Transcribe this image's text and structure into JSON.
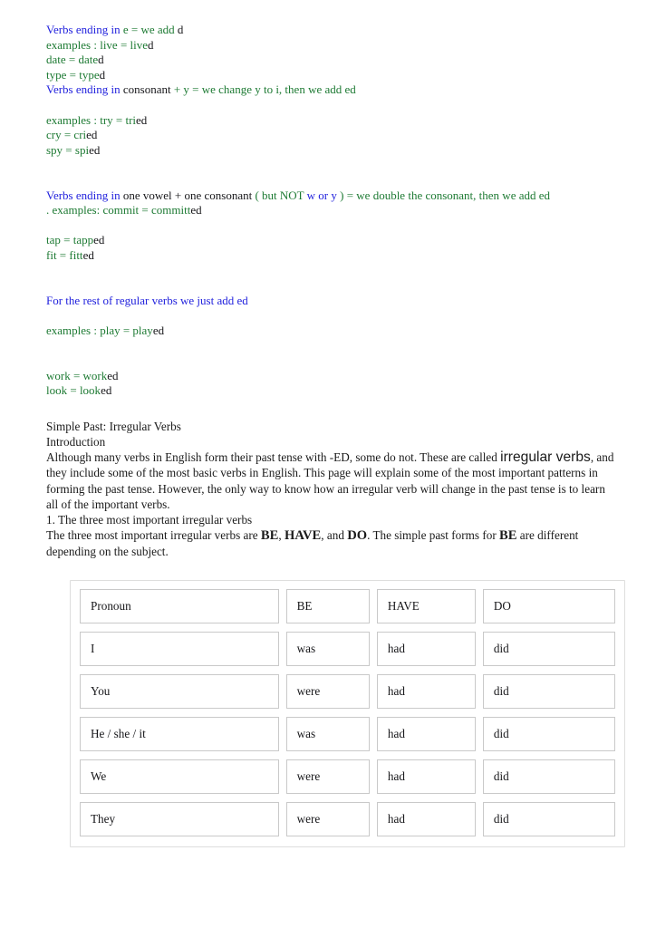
{
  "colors": {
    "blue": "#2222dd",
    "green": "#1d7a33",
    "black": "#17171a",
    "cell_border": "#c9c9c9",
    "table_border": "#dededd"
  },
  "rules": {
    "rule1": {
      "head_blue": "Verbs ending in",
      "head_green": " e = we add ",
      "head_black": "d",
      "examples": [
        {
          "green": "examples : live = live",
          "black": "d"
        },
        {
          "green": "date = date",
          "black": "d"
        },
        {
          "green": "type = type",
          "black": "d"
        }
      ]
    },
    "rule2": {
      "head_blue": "Verbs ending in",
      "head_black": " consonant",
      "head_green": " + y = we change y to i, then we add ed",
      "examples": [
        {
          "green": "examples : try = tri",
          "black": "ed"
        },
        {
          "green": "cry = cri",
          "black": "ed"
        },
        {
          "green": "spy = spi",
          "black": "ed"
        }
      ]
    },
    "rule3": {
      "head_blue": "Verbs ending in",
      "head_black_1": " one vowel + one consonant",
      "head_green_1": " ( but NOT ",
      "head_blue_2": "w or y",
      "head_green_2": " ) = we double the consonant, then we add ed",
      "example_line": {
        "green": ". examples: commit = committ",
        "black": "ed"
      },
      "examples": [
        {
          "green": "tap = tapp",
          "black": "ed"
        },
        {
          "green": "fit = fitt",
          "black": "ed"
        }
      ]
    },
    "rule4": {
      "head_blue": "For the rest of regular verbs we just add ed",
      "examples_1": [
        {
          "green": "examples : play = play",
          "black": "ed"
        }
      ],
      "examples_2": [
        {
          "green": "work = work",
          "black": "ed"
        },
        {
          "green": "look = look",
          "black": "ed"
        }
      ]
    }
  },
  "prose": {
    "heading": "Simple Past: Irregular Verbs",
    "subheading": "Introduction",
    "para1_a": "Although many verbs in English form their past tense with -ED, some do not. These are called ",
    "para1_emph": "irregular verbs",
    "para1_b": ", and they include some of the most basic verbs in English. This page will explain some of the most important patterns in forming the past tense. However, the only way to know how an irregular verb will change in the past tense is to learn all of the important verbs.",
    "list_item_1": "1. The three most important irregular verbs",
    "para2_a": "The three most important irregular verbs are ",
    "para2_be": "BE",
    "para2_b": ", ",
    "para2_have": "HAVE",
    "para2_c": ", and ",
    "para2_do": "DO",
    "para2_d": ". The simple past forms for ",
    "para2_be2": "BE",
    "para2_e": " are different depending on the subject."
  },
  "table": {
    "headers": [
      "Pronoun",
      "BE",
      "HAVE",
      "DO"
    ],
    "rows": [
      [
        "I",
        "was",
        "had",
        "did"
      ],
      [
        "You",
        "were",
        "had",
        "did"
      ],
      [
        "He / she / it",
        "was",
        "had",
        "did"
      ],
      [
        "We",
        "were",
        "had",
        "did"
      ],
      [
        "They",
        "were",
        "had",
        "did"
      ]
    ]
  }
}
